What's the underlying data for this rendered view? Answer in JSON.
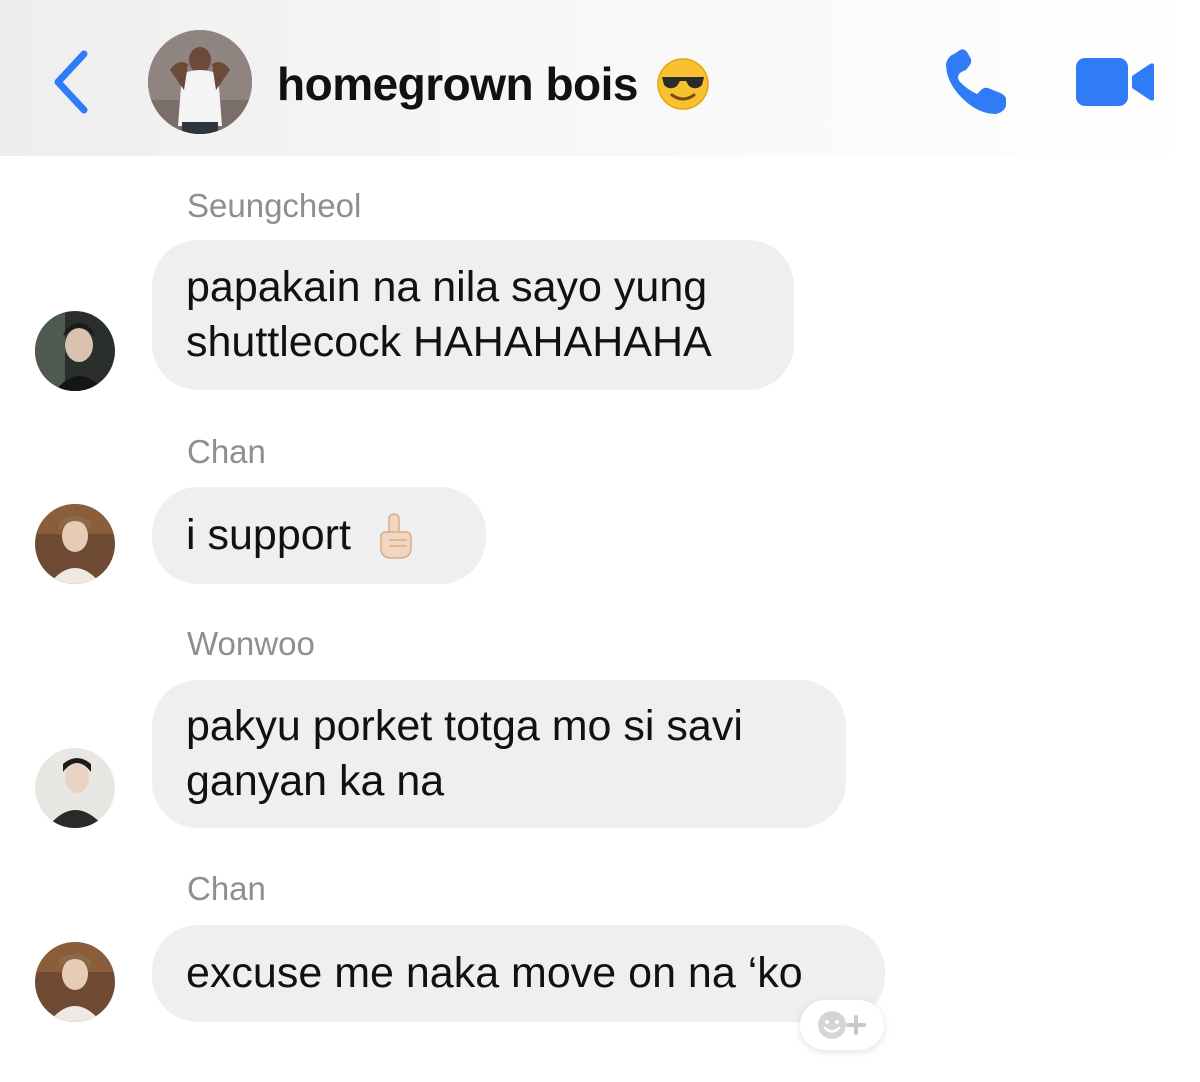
{
  "header": {
    "title": "homegrown bois",
    "title_emoji": "smiling-face-with-sunglasses",
    "accent_color": "#2f7cf6",
    "back_icon": "chevron-left-icon",
    "call_icon": "phone-icon",
    "video_icon": "video-camera-icon"
  },
  "messages": [
    {
      "sender": "Seungcheol",
      "lines": [
        "papakain na nila sayo yung",
        "shuttlecock HAHAHAHAHA"
      ]
    },
    {
      "sender": "Chan",
      "text": "i support",
      "emoji": "index-pointing-up"
    },
    {
      "sender": "Wonwoo",
      "lines": [
        "pakyu porket totga mo si savi",
        "ganyan ka na"
      ]
    },
    {
      "sender": "Chan",
      "text": "excuse me naka move on na ‘ko"
    }
  ],
  "reaction_button": {
    "icon": "add-reaction-icon"
  },
  "colors": {
    "bubble": "#efefef",
    "sender_text": "#8e8e93",
    "message_text": "#111111"
  }
}
